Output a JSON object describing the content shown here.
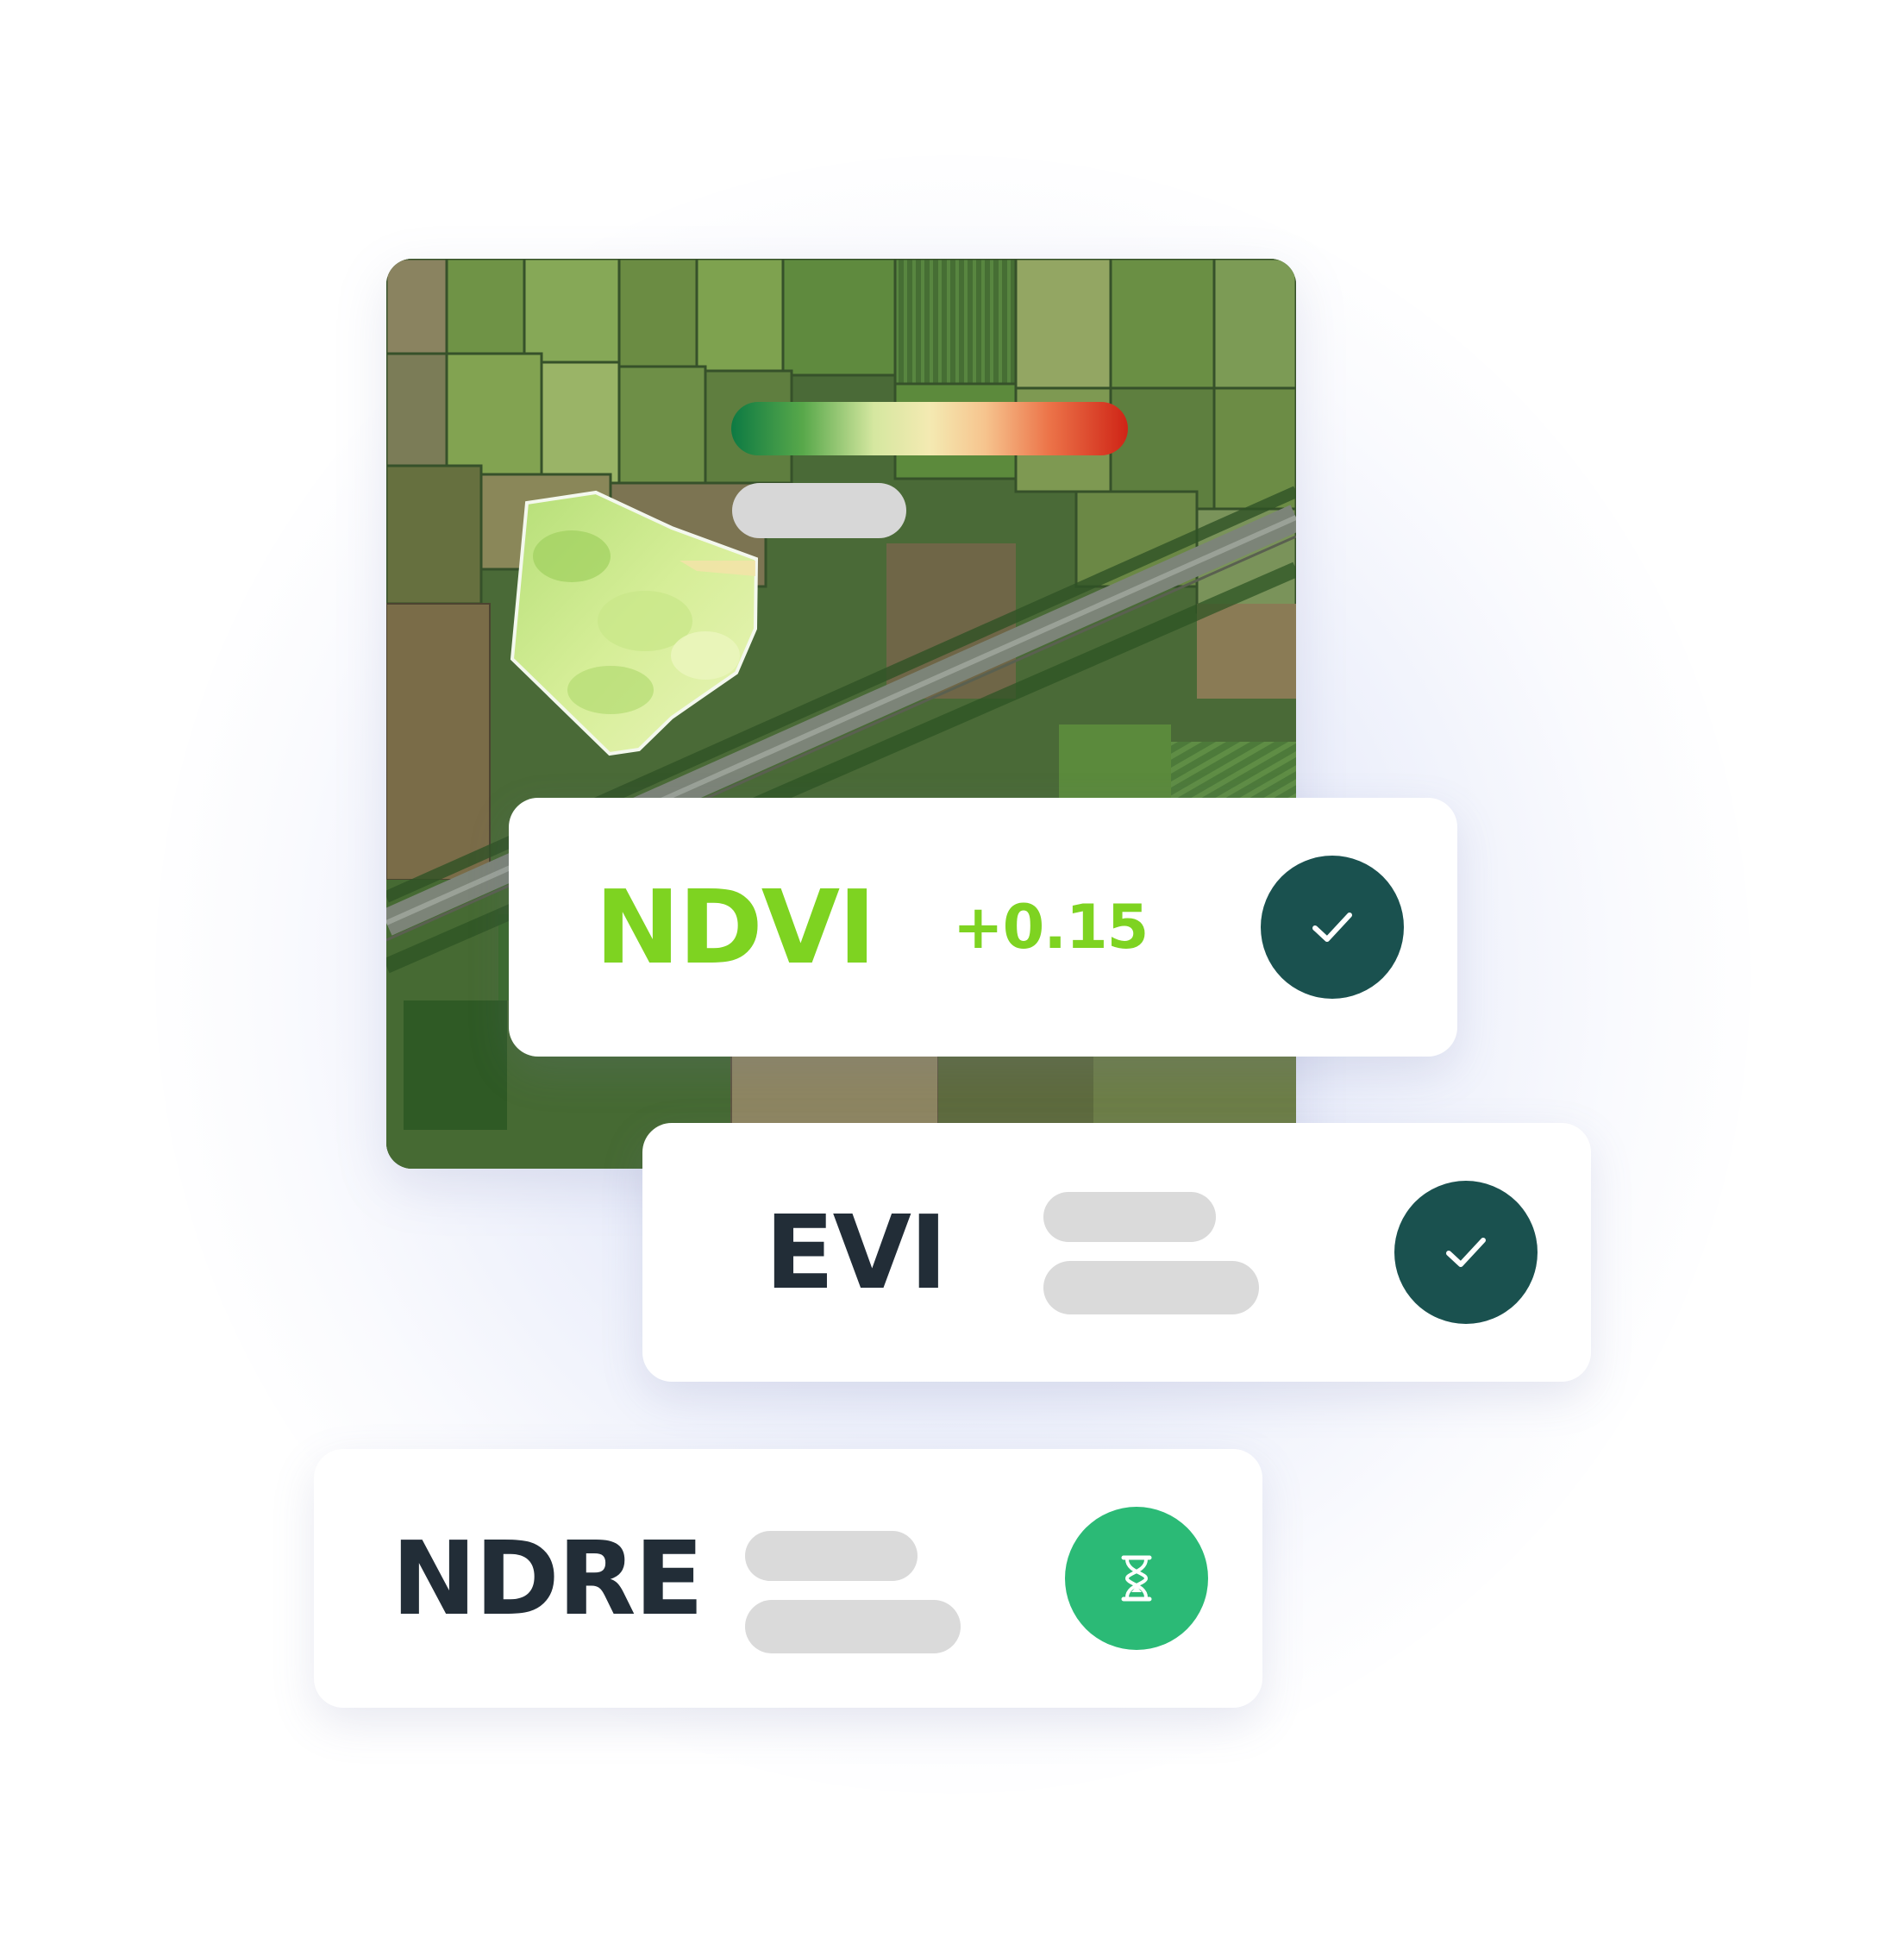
{
  "colors": {
    "ndvi_accent": "#7ed321",
    "dark_text": "#222d37",
    "check_button_bg": "#1a514f",
    "pending_button_bg": "#2bba76",
    "placeholder_pill": "#d9d9d9"
  },
  "map": {
    "legend_scale_colors": [
      "#0d7a43",
      "#58a84a",
      "#d5e7a0",
      "#f4eab2",
      "#f6c48e",
      "#ec7449",
      "#cf2416"
    ],
    "legend_label_placeholder": true
  },
  "indices": [
    {
      "name": "NDVI",
      "value": "+0.15",
      "status": "completed",
      "status_icon": "checkmark-icon"
    },
    {
      "name": "EVI",
      "value": "",
      "status": "completed",
      "status_icon": "checkmark-icon"
    },
    {
      "name": "NDRE",
      "value": "",
      "status": "pending",
      "status_icon": "hourglass-icon"
    }
  ]
}
